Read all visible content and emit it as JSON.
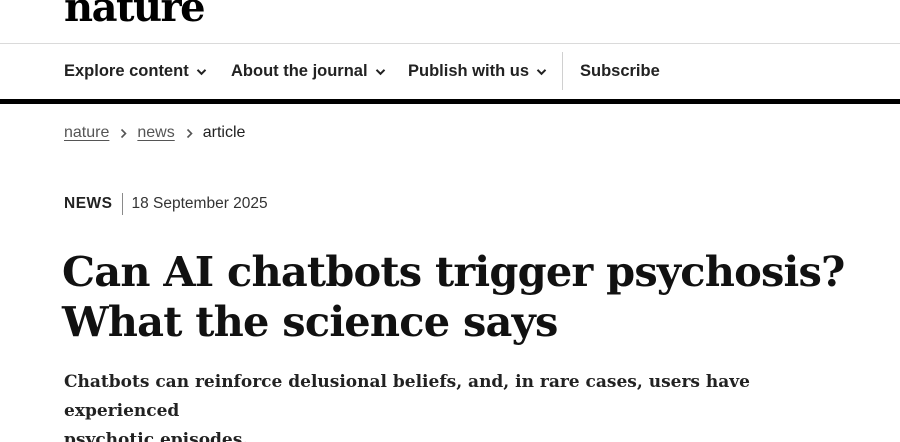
{
  "brand": {
    "logo_text": "nature"
  },
  "nav": {
    "items": [
      {
        "label": "Explore content",
        "has_dropdown": true,
        "icon": "chevron-down-icon"
      },
      {
        "label": "About the journal",
        "has_dropdown": true,
        "icon": "chevron-down-icon"
      },
      {
        "label": "Publish with us",
        "has_dropdown": true,
        "icon": "chevron-down-icon"
      },
      {
        "label": "Subscribe",
        "has_dropdown": false
      }
    ]
  },
  "breadcrumb": {
    "items": [
      {
        "label": "nature",
        "link": true
      },
      {
        "label": "news",
        "link": true
      },
      {
        "label": "article",
        "link": false
      }
    ],
    "separator_icon": "chevron-right-icon"
  },
  "article": {
    "type": "NEWS",
    "date": "18 September 2025",
    "title_line1": "Can AI chatbots trigger psychosis?",
    "title_line2": "What the science says",
    "standfirst_line1": "Chatbots can reinforce delusional beliefs, and, in rare cases, users have experienced",
    "standfirst_line2": "psychotic episodes."
  },
  "colors": {
    "text": "#222222",
    "logo": "#000000",
    "nav_rule": "#000000",
    "divider": "#dadada",
    "link": "#555555"
  }
}
